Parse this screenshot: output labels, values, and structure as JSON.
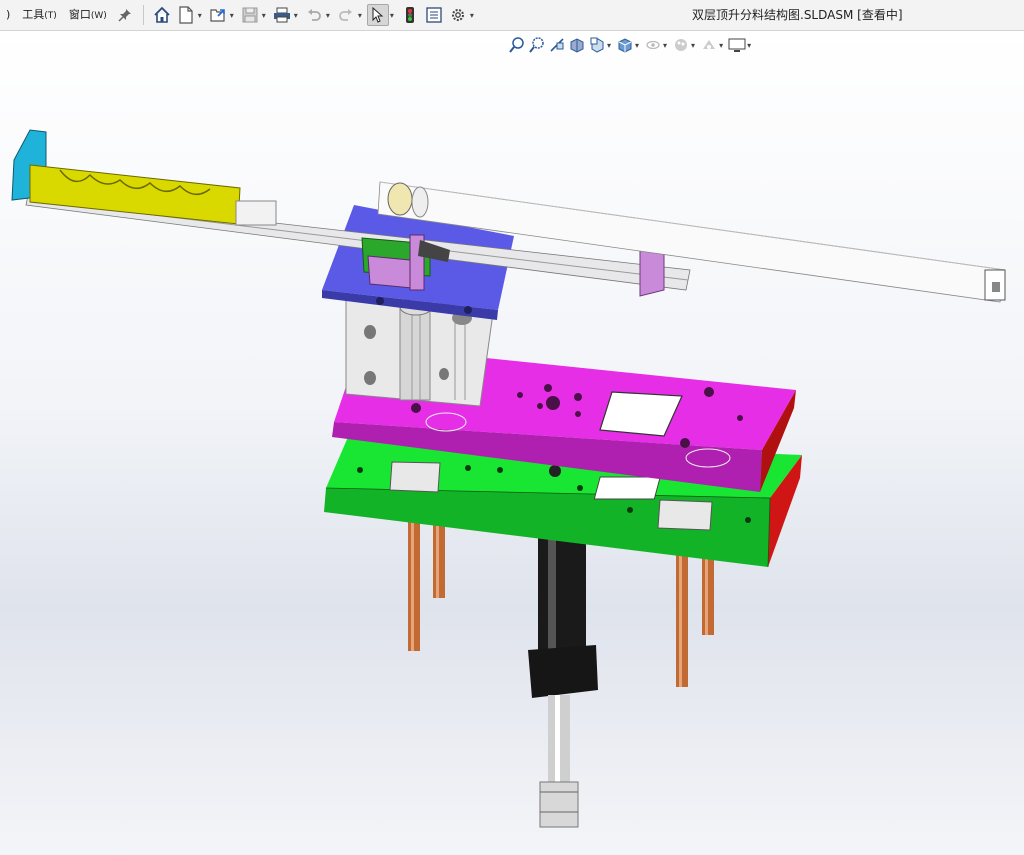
{
  "menu": {
    "fragment": ")",
    "tools": "工具",
    "tools_key": "(T)",
    "window": "窗口",
    "window_key": "(W)"
  },
  "window_title": "双层顶升分料结构图.SLDASM [查看中]",
  "toolbar_icons": [
    "pin-icon",
    "home-icon",
    "new-document-icon",
    "open-icon",
    "save-icon",
    "print-icon",
    "undo-icon",
    "redo-icon",
    "select-pointer-icon",
    "rebuild-traffic-light-icon",
    "file-properties-icon",
    "options-gear-icon"
  ],
  "heads_up_icons": [
    "zoom-to-fit-icon",
    "zoom-to-area-icon",
    "previous-view-icon",
    "section-view-icon",
    "view-orientation-icon",
    "display-style-icon",
    "hide-show-items-icon",
    "edit-appearance-icon",
    "apply-scene-icon",
    "view-settings-icon"
  ],
  "colors": {
    "magenta_plate": "#e62ee6",
    "green_plate": "#19e632",
    "blue_plate": "#5a5ae6",
    "yellow_rail": "#d9d900",
    "cyan_end": "#1fb3d9",
    "copper_rod": "#c26a33",
    "lilac_block": "#c98ad9"
  }
}
